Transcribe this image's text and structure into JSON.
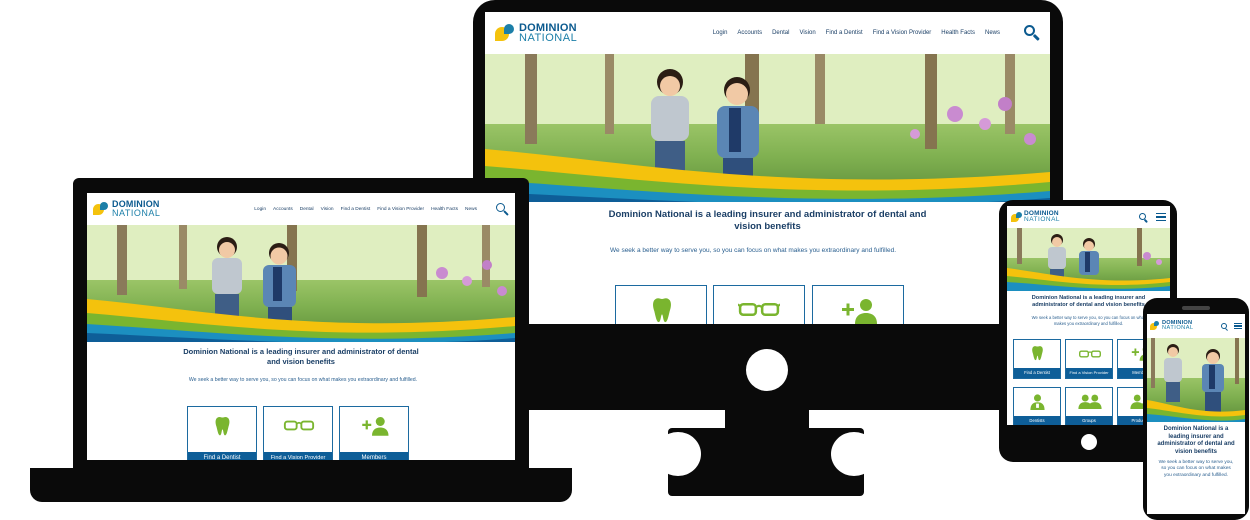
{
  "brand": {
    "line1": "DOMINION",
    "line2": "NATIONAL"
  },
  "nav": {
    "items": [
      "Login",
      "Accounts",
      "Dental",
      "Vision",
      "Find a Dentist",
      "Find a Vision Provider",
      "Health Facts",
      "News"
    ]
  },
  "content": {
    "headline": "Dominion National is a leading insurer and administrator of dental and vision benefits",
    "subtext": "We seek a better way to serve you, so you can focus on what makes you extraordinary and fulfilled."
  },
  "cards": {
    "find_dentist": "Find a Dentist",
    "find_vision": "Find a Vision Provider",
    "members": "Members",
    "dentists": "Dentists",
    "groups": "Groups",
    "producers": "Producers"
  },
  "icons": [
    "tooth-icon",
    "glasses-icon",
    "add-member-icon",
    "dentist-icon",
    "groups-icon",
    "search-icon",
    "menu-icon"
  ],
  "colors": {
    "brand_blue": "#0b5a8f",
    "card_blue": "#0e5e98",
    "accent_green": "#7ab52f",
    "accent_yellow": "#f4c20d",
    "device_black": "#0a0a0a"
  }
}
